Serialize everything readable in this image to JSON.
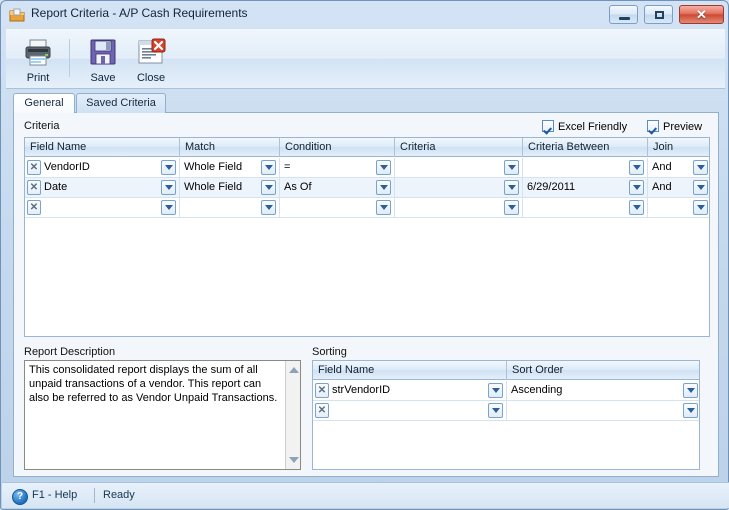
{
  "window": {
    "title": "Report Criteria - A/P Cash Requirements",
    "icon": "report-folder-icon",
    "controls": {
      "minimize": "minimize-button",
      "maximize": "maximize-button",
      "close": "close-button",
      "close_glyph": "✕"
    }
  },
  "toolbar": {
    "buttons": [
      {
        "label": "Print",
        "icon": "printer-icon"
      },
      {
        "label": "Save",
        "icon": "floppy-disk-icon"
      },
      {
        "label": "Close",
        "icon": "close-document-icon"
      }
    ]
  },
  "tabs": [
    {
      "label": "General",
      "active": true
    },
    {
      "label": "Saved Criteria",
      "active": false
    }
  ],
  "criteria_section": {
    "caption": "Criteria",
    "options": [
      {
        "label": "Excel Friendly",
        "checked": true
      },
      {
        "label": "Preview",
        "checked": true
      }
    ],
    "columns": [
      "Field Name",
      "Match",
      "Condition",
      "Criteria",
      "Criteria Between",
      "Join"
    ],
    "rows": [
      {
        "field_name": "VendorID",
        "match": "Whole Field",
        "condition": "=",
        "criteria": "",
        "criteria_between": "",
        "join": "And"
      },
      {
        "field_name": "Date",
        "match": "Whole Field",
        "condition": "As Of",
        "criteria": "",
        "criteria_between": "6/29/2011",
        "join": "And"
      },
      {
        "field_name": "",
        "match": "",
        "condition": "",
        "criteria": "",
        "criteria_between": "",
        "join": ""
      }
    ],
    "delete_row_glyph": "✕"
  },
  "description_section": {
    "caption": "Report Description",
    "text": "This consolidated report displays the sum of all unpaid transactions of a vendor. This report can also be referred to as Vendor Unpaid Transactions."
  },
  "sorting_section": {
    "caption": "Sorting",
    "columns": [
      "Field Name",
      "Sort Order"
    ],
    "rows": [
      {
        "field_name": "strVendorID",
        "sort_order": "Ascending"
      },
      {
        "field_name": "",
        "sort_order": ""
      }
    ]
  },
  "statusbar": {
    "help": "F1 - Help",
    "status": "Ready",
    "help_glyph": "?"
  },
  "colors": {
    "accent": "#2b5f9e",
    "header_gradient_top": "#f1f7fd",
    "header_gradient_bottom": "#cfe1f3",
    "alt_row": "#eef4fb",
    "close_button": "#cf4a33",
    "window_border": "#6f93b8"
  }
}
